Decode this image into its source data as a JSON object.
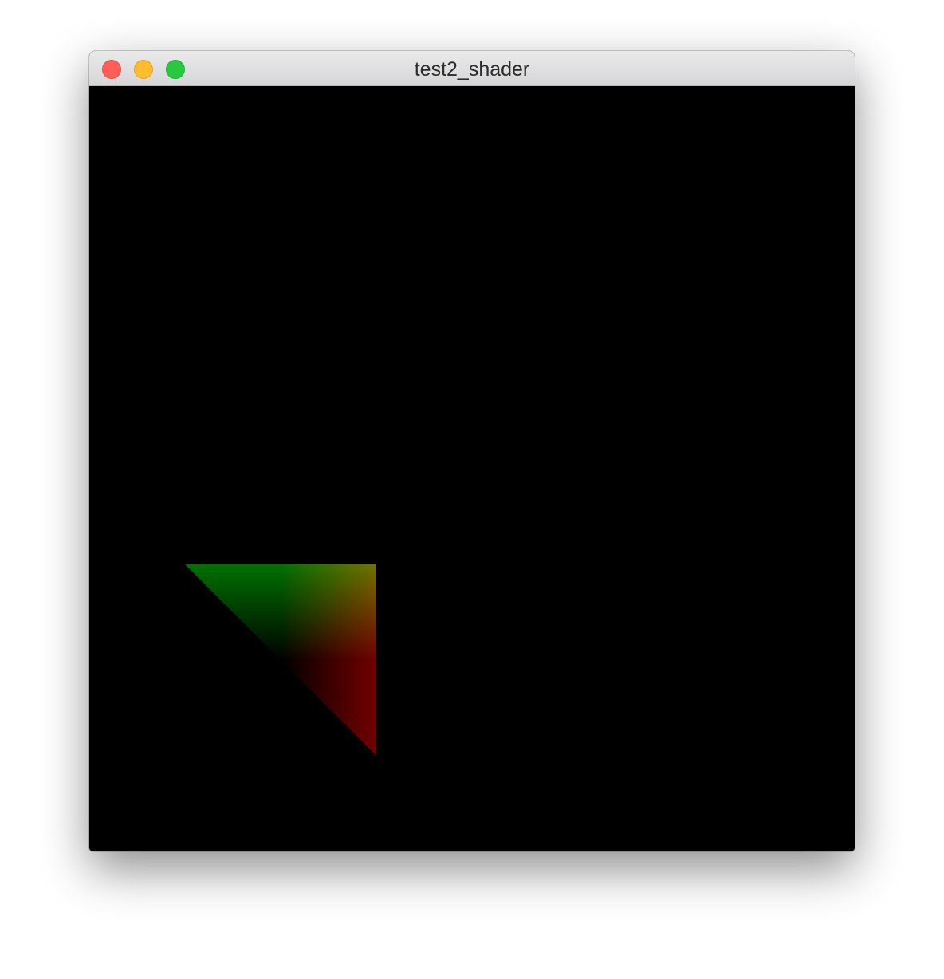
{
  "window": {
    "title": "test2_shader",
    "controls": {
      "close_color": "#fe5f57",
      "minimize_color": "#febc2e",
      "zoom_color": "#28c840"
    }
  },
  "viewport": {
    "background": "#000000",
    "shape": "triangle",
    "colors": {
      "top_left": "#007200",
      "top_right": "#727200",
      "bottom_right": "#720000",
      "center_dark": "#000000"
    }
  }
}
